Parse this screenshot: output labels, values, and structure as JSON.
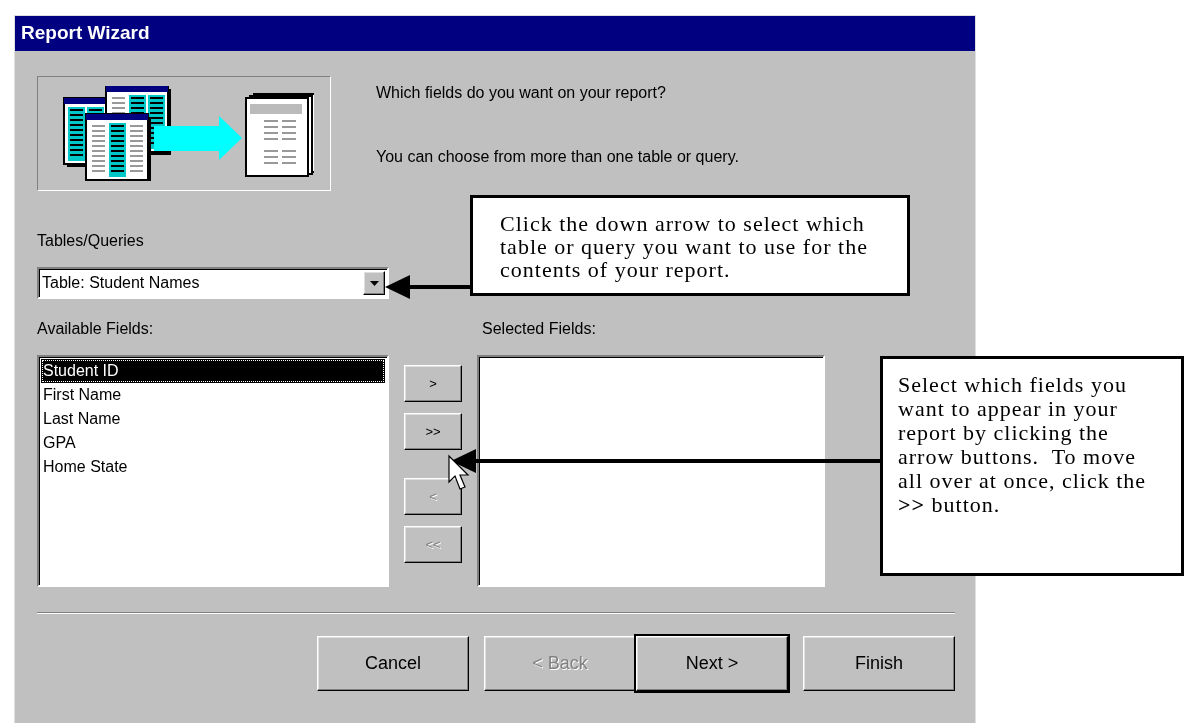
{
  "window": {
    "title": "Report Wizard"
  },
  "intro": [
    "Which fields do you want on your report?",
    "You can choose from more than one table or query."
  ],
  "source": {
    "label": "Tables/Queries",
    "value": "Table: Student Names"
  },
  "available_fields": {
    "label": "Available Fields:",
    "items": [
      {
        "text": "Student ID",
        "selected": true
      },
      {
        "text": "First Name",
        "selected": false
      },
      {
        "text": "Last Name",
        "selected": false
      },
      {
        "text": "GPA",
        "selected": false
      },
      {
        "text": "Home State",
        "selected": false
      }
    ]
  },
  "move_buttons": [
    {
      "label": ">",
      "disabled": false
    },
    {
      "label": ">>",
      "disabled": false
    },
    {
      "label": "<",
      "disabled": true
    },
    {
      "label": "<<",
      "disabled": true
    }
  ],
  "selected_fields": {
    "label": "Selected Fields:"
  },
  "buttons": [
    {
      "label": "Cancel",
      "disabled": false,
      "default": false
    },
    {
      "label": "< Back",
      "disabled": true,
      "default": false
    },
    {
      "label": "Next >",
      "disabled": false,
      "default": true
    },
    {
      "label": "Finish",
      "disabled": false,
      "default": false
    }
  ],
  "callouts": [
    {
      "text": "Click the down arrow to select which table or query you want to use for the contents of your report."
    },
    {
      "text": "Select which fields you want to appear in your report by clicking the arrow buttons.  To move all over at once, click the **>>** button."
    }
  ]
}
